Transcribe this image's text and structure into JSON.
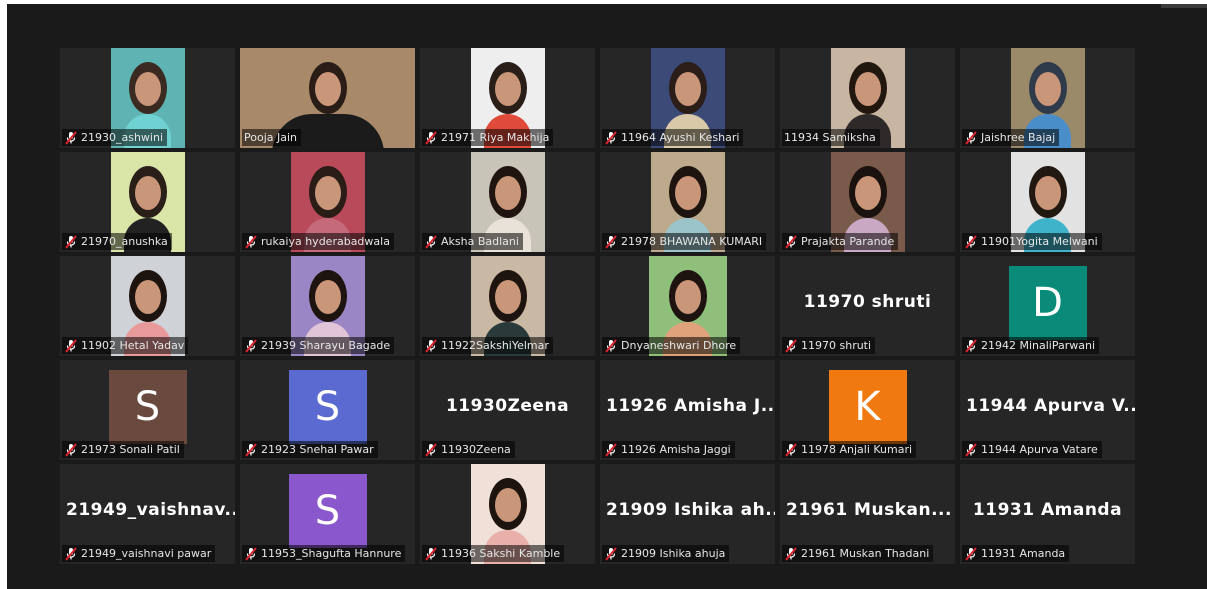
{
  "colors": {
    "window_bg": "#1a1a1a",
    "tile_bg": "#262626",
    "active_speaker_border": "#c6d93f",
    "muted_icon": "#e0242d",
    "label_text": "#e6e6e6"
  },
  "participants": [
    {
      "label": "21930_ashwini",
      "muted": true,
      "type": "video",
      "palette": [
        "#5fb3b3",
        "#3a2a22",
        "#6fd1d1"
      ]
    },
    {
      "label": "Pooja Jain",
      "muted": false,
      "type": "video",
      "speaking": true,
      "palette": [
        "#a88a6a",
        "#2a1c16",
        "#1b1b1b"
      ]
    },
    {
      "label": "21971 Riya Makhija",
      "muted": true,
      "type": "video",
      "palette": [
        "#eeeeee",
        "#2a1e18",
        "#e04a3a"
      ]
    },
    {
      "label": "11964 Ayushi Keshari",
      "muted": true,
      "type": "video",
      "palette": [
        "#3c4a78",
        "#2b1d18",
        "#d9c9a8"
      ]
    },
    {
      "label": "11934 Samiksha",
      "muted": false,
      "type": "video",
      "palette": [
        "#c9b6a2",
        "#22170f",
        "#2f2a2a"
      ]
    },
    {
      "label": "Jaishree Bajaj",
      "muted": true,
      "type": "video",
      "palette": [
        "#9a8a6a",
        "#2f3a4a",
        "#4a8ec9"
      ]
    },
    {
      "label": "21970_anushka",
      "muted": true,
      "type": "video",
      "palette": [
        "#d9e6a8",
        "#2a1e18",
        "#222222"
      ]
    },
    {
      "label": "rukaiya hyderabadwala",
      "muted": true,
      "type": "video",
      "palette": [
        "#b84a5a",
        "#2a1c16",
        "#c46a7a"
      ]
    },
    {
      "label": "Aksha Badlani",
      "muted": true,
      "type": "video",
      "palette": [
        "#c9c4b8",
        "#1f1410",
        "#e8e2d8"
      ]
    },
    {
      "label": "21978 BHAWANA KUMARI",
      "muted": true,
      "type": "video",
      "palette": [
        "#bda98c",
        "#1d1410",
        "#9ac4c9"
      ]
    },
    {
      "label": "Prajakta Parande",
      "muted": true,
      "type": "video",
      "palette": [
        "#7a5a4a",
        "#1a120e",
        "#c9a8c4"
      ]
    },
    {
      "label": "11901Yogita Melwani",
      "muted": true,
      "type": "video",
      "palette": [
        "#e2e2e2",
        "#221812",
        "#3fb3c9"
      ]
    },
    {
      "label": "11902 Hetal Yadav",
      "muted": true,
      "type": "video",
      "palette": [
        "#cfd2d6",
        "#1d1410",
        "#e89a9a"
      ]
    },
    {
      "label": "21939 Sharayu Bagade",
      "muted": true,
      "type": "video",
      "palette": [
        "#9a86c4",
        "#1d1410",
        "#e0c4d8"
      ]
    },
    {
      "label": "11922SakshiYelmar",
      "muted": true,
      "type": "video",
      "palette": [
        "#c9b9a4",
        "#1d1410",
        "#2a3a3a"
      ]
    },
    {
      "label": "Dnyaneshwari Dhore",
      "muted": true,
      "type": "video",
      "palette": [
        "#8fbf7a",
        "#1d1410",
        "#e0a27a"
      ],
      "narrow": true
    },
    {
      "label": "11970 shruti",
      "muted": true,
      "type": "name",
      "display": "11970 shruti"
    },
    {
      "label": "21942 MinaliParwani",
      "muted": true,
      "type": "avatar",
      "letter": "D",
      "color": "#0a8a78"
    },
    {
      "label": "21973 Sonali Patil",
      "muted": true,
      "type": "avatar",
      "letter": "S",
      "color": "#6a4a3e"
    },
    {
      "label": "21923 Snehal Pawar",
      "muted": true,
      "type": "avatar",
      "letter": "S",
      "color": "#5a6ad0"
    },
    {
      "label": "11930Zeena",
      "muted": true,
      "type": "name",
      "display": "11930Zeena"
    },
    {
      "label": "11926 Amisha Jaggi",
      "muted": true,
      "type": "name",
      "display": "11926  Amisha  J..."
    },
    {
      "label": "11978 Anjali Kumari",
      "muted": true,
      "type": "avatar",
      "letter": "K",
      "color": "#f07a10"
    },
    {
      "label": "11944 Apurva Vatare",
      "muted": true,
      "type": "name",
      "display": "11944  Apurva  V..."
    },
    {
      "label": "21949_vaishnavi pawar",
      "muted": true,
      "type": "name",
      "display": "21949_vaishnav..."
    },
    {
      "label": "11953_Shagufta Hannure",
      "muted": true,
      "type": "avatar",
      "letter": "S",
      "color": "#8a58cc"
    },
    {
      "label": "11936 Sakshi Kamble",
      "muted": true,
      "type": "video",
      "palette": [
        "#f0e0d8",
        "#1d1410",
        "#e8b0a8"
      ]
    },
    {
      "label": "21909 Ishika ahuja",
      "muted": true,
      "type": "name",
      "display": "21909  Ishika  ah..."
    },
    {
      "label": "21961 Muskan Thadani",
      "muted": true,
      "type": "name",
      "display": "21961  Muskan..."
    },
    {
      "label": "11931 Amanda",
      "muted": true,
      "type": "name",
      "display": "11931  Amanda"
    }
  ]
}
